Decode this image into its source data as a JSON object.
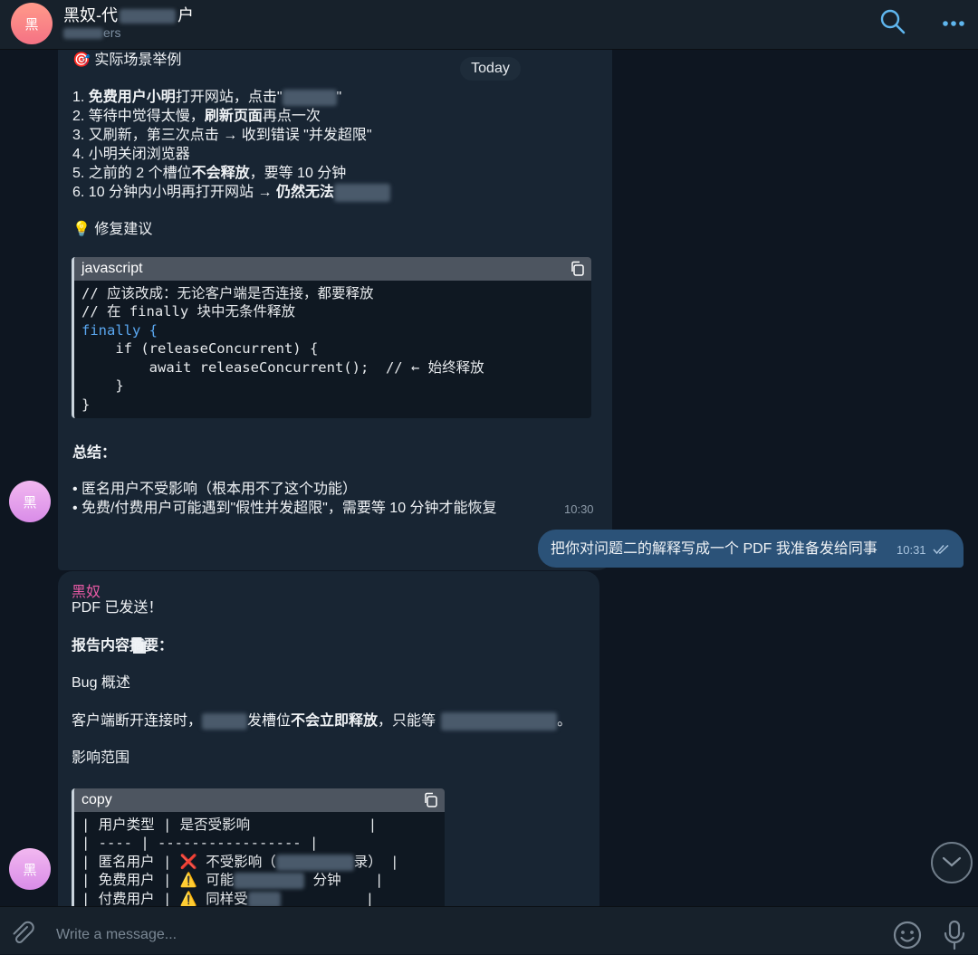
{
  "header": {
    "avatar_glyph": "黑",
    "title_prefix": "黑奴-代",
    "title_suffix": "户",
    "subtitle": "ers"
  },
  "chat": {
    "date_badge": "Today",
    "msg1": {
      "heading_emoji": "🎯",
      "heading": "实际场景举例",
      "steps": [
        {
          "num": "1.",
          "normal": "",
          "bold": "免费用户小明",
          "after": "打开网站，点击\""
        },
        {
          "num": "2.",
          "text": "等待中觉得太慢，",
          "bold": "刷新页面",
          "after": "再点一次"
        },
        {
          "num": "3.",
          "text": "又刷新，第三次点击 → 收到错误 \"并发超限\""
        },
        {
          "num": "4.",
          "text": "小明关闭浏览器"
        },
        {
          "num": "5.",
          "text": "之前的 2 个槽位",
          "bold": "不会释放",
          "after": "，要等 10 分钟"
        },
        {
          "num": "6.",
          "text": "10 分钟内小明再打开网站 → ",
          "bold": "仍然无法"
        }
      ],
      "fix_emoji": "💡",
      "fix_heading": "修复建议",
      "code_lang": "javascript",
      "code_lines": [
        "// 应该改成：无论客户端是否连接，都要释放",
        "// 在 finally 块中无条件释放",
        "finally {",
        "    if (releaseConcurrent) {",
        "        await releaseConcurrent();  // ← 始终释放",
        "    }",
        "}"
      ],
      "summary_title": "总结：",
      "summary_items": [
        "• 匿名用户不受影响（根本用不了这个功能）",
        "• 免费/付费用户可能遇到\"假性并发超限\"，需要等 10 分钟才能恢复"
      ],
      "time": "10:30"
    },
    "msg_out": {
      "text": "把你对问题二的解释写成一个 PDF 我准备发给同事",
      "time": "10:31"
    },
    "msg2": {
      "sender": "黑奴",
      "line1": "PDF 已发送！",
      "summary_heading": "报告内容摘要：",
      "bug_heading": "Bug 概述",
      "bug_text_a": "客户端断开连接时，",
      "bug_text_b": "发槽位",
      "bug_text_bold": "不会立即释放",
      "bug_text_c": "，只能等",
      "bug_text_d": "。",
      "impact_heading": "影响范围",
      "code_lang": "copy",
      "table_lines": [
        "| 用户类型 | 是否受影响              |",
        "| ---- | ----------------- |",
        "| 匿名用户 | ❌ 不受影响（",
        "| 免费用户 | ⚠️ 可能",
        "| 付费用户 | ⚠️ 同样受"
      ],
      "table_tail_1": "录） |",
      "table_tail_2": "分钟    |",
      "table_tail_3": "|"
    }
  },
  "composer": {
    "placeholder": "Write a message..."
  },
  "colors": {
    "background": "#0e1621",
    "bubble_in": "#182533",
    "bubble_out": "#2b5278",
    "accent": "#5fb6ee",
    "sender": "#e85aa5"
  },
  "icons": [
    "search-icon",
    "more-icon",
    "copy-icon",
    "chevron-down-icon",
    "attach-icon",
    "emoji-icon",
    "mic-icon",
    "double-check-icon",
    "document-icon"
  ]
}
